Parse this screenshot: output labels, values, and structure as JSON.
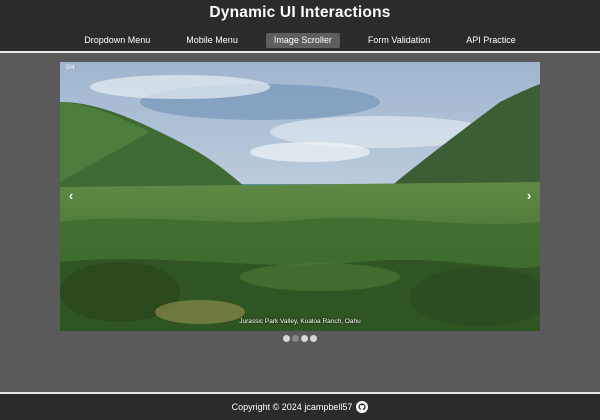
{
  "header": {
    "title": "Dynamic UI Interactions",
    "nav": [
      {
        "label": "Dropdown Menu",
        "active": false
      },
      {
        "label": "Mobile Menu",
        "active": false
      },
      {
        "label": "Image Scroller",
        "active": true
      },
      {
        "label": "Form Validation",
        "active": false
      },
      {
        "label": "API Practice",
        "active": false
      }
    ]
  },
  "scroller": {
    "counter": "2/4",
    "prev_icon": "‹",
    "next_icon": "›",
    "caption": "Jurassic Park Valley, Kualoa Ranch, Oahu",
    "dot_count": 4,
    "active_dot": 2
  },
  "footer": {
    "text": "Copyright © 2024 jcampbell57",
    "icon": "github-icon"
  },
  "colors": {
    "header_bg": "#2b2b2b",
    "page_bg": "#5a5a5a",
    "active_nav_bg": "#5e5e5e"
  }
}
